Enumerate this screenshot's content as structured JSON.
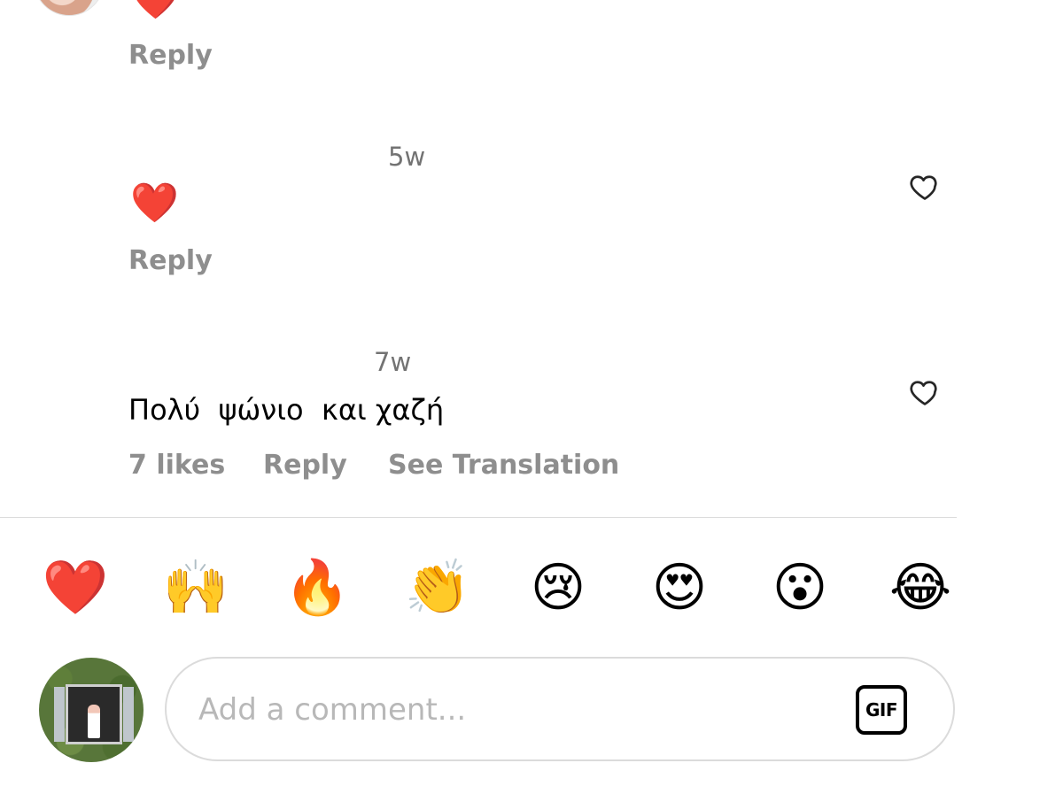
{
  "comments": [
    {
      "time": "",
      "text": "❤️",
      "actions": {
        "likes": "",
        "reply": "Reply",
        "translate": ""
      }
    },
    {
      "time": "5w",
      "text": "❤️",
      "actions": {
        "likes": "",
        "reply": "Reply",
        "translate": ""
      }
    },
    {
      "time": "7w",
      "text": "Πολύ  ψώνιο  και χαζή",
      "actions": {
        "likes": "7 likes",
        "reply": "Reply",
        "translate": "See Translation"
      }
    }
  ],
  "reactions": [
    "❤️",
    "🙌",
    "🔥",
    "👏",
    "😢",
    "😍",
    "😮",
    "😂"
  ],
  "composer": {
    "placeholder": "Add a comment...",
    "gif_label": "GIF"
  },
  "icons": {
    "like": "heart-outline-icon",
    "gif": "gif-icon"
  }
}
